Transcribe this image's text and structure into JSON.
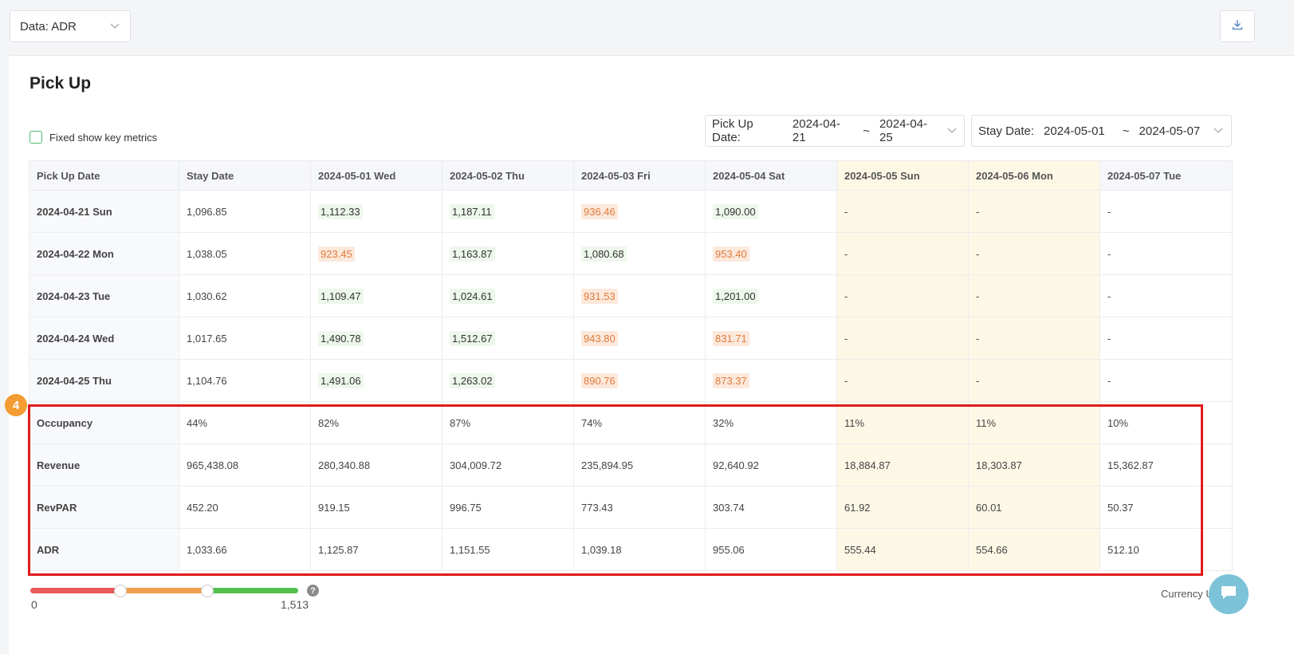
{
  "data_select": {
    "label": "Data: ADR"
  },
  "title": "Pick Up",
  "fixed_checkbox_label": "Fixed show key metrics",
  "pickup_picker": {
    "label": "Pick Up Date:",
    "start": "2024-04-21",
    "sep": "~",
    "end": "2024-04-25"
  },
  "stay_picker": {
    "label": "Stay Date:",
    "start": "2024-05-01",
    "sep": "~",
    "end": "2024-05-07"
  },
  "table": {
    "headers": [
      "Pick Up Date",
      "Stay Date",
      "2024-05-01 Wed",
      "2024-05-02 Thu",
      "2024-05-03 Fri",
      "2024-05-04 Sat",
      "2024-05-05 Sun",
      "2024-05-06 Mon",
      "2024-05-07 Tue"
    ],
    "rows": [
      {
        "label": "2024-04-21 Sun",
        "cells": [
          "1,096.85",
          "1,112.33",
          "1,187.11",
          "936.46",
          "1,090.00",
          "-",
          "-",
          "-"
        ],
        "tones": [
          "",
          "up",
          "up",
          "down",
          "up",
          "",
          "",
          ""
        ]
      },
      {
        "label": "2024-04-22 Mon",
        "cells": [
          "1,038.05",
          "923.45",
          "1,163.87",
          "1,080.68",
          "953.40",
          "-",
          "-",
          "-"
        ],
        "tones": [
          "",
          "down",
          "up",
          "up",
          "down",
          "",
          "",
          ""
        ]
      },
      {
        "label": "2024-04-23 Tue",
        "cells": [
          "1,030.62",
          "1,109.47",
          "1,024.61",
          "931.53",
          "1,201.00",
          "-",
          "-",
          "-"
        ],
        "tones": [
          "",
          "up",
          "up",
          "down",
          "up",
          "",
          "",
          ""
        ]
      },
      {
        "label": "2024-04-24 Wed",
        "cells": [
          "1,017.65",
          "1,490.78",
          "1,512.67",
          "943.80",
          "831.71",
          "-",
          "-",
          "-"
        ],
        "tones": [
          "",
          "up",
          "up",
          "down",
          "down",
          "",
          "",
          ""
        ]
      },
      {
        "label": "2024-04-25 Thu",
        "cells": [
          "1,104.76",
          "1,491.06",
          "1,263.02",
          "890.76",
          "873.37",
          "-",
          "-",
          "-"
        ],
        "tones": [
          "",
          "up",
          "up",
          "down",
          "down",
          "",
          "",
          ""
        ]
      }
    ],
    "metrics": [
      {
        "label": "Occupancy",
        "cells": [
          "44%",
          "82%",
          "87%",
          "74%",
          "32%",
          "11%",
          "11%",
          "10%"
        ]
      },
      {
        "label": "Revenue",
        "cells": [
          "965,438.08",
          "280,340.88",
          "304,009.72",
          "235,894.95",
          "92,640.92",
          "18,884.87",
          "18,303.87",
          "15,362.87"
        ]
      },
      {
        "label": "RevPAR",
        "cells": [
          "452.20",
          "919.15",
          "996.75",
          "773.43",
          "303.74",
          "61.92",
          "60.01",
          "50.37"
        ]
      },
      {
        "label": "ADR",
        "cells": [
          "1,033.66",
          "1,125.87",
          "1,151.55",
          "1,039.18",
          "955.06",
          "555.44",
          "554.66",
          "512.10"
        ]
      }
    ],
    "highlight_columns": [
      6,
      7
    ]
  },
  "step_badge": "4",
  "slider": {
    "min": "0",
    "max": "1,513",
    "colors": [
      "#e8595a",
      "#f0a04c",
      "#52c04f"
    ]
  },
  "help_icon": "?",
  "currency_label": "Currency Unit:",
  "colors": {
    "accent_green": "#52b86c",
    "highlight_col": "#fdf8e6",
    "down_text": "#e07b3c",
    "annotation_red": "#e01b1b",
    "badge_orange": "#f39c32"
  }
}
